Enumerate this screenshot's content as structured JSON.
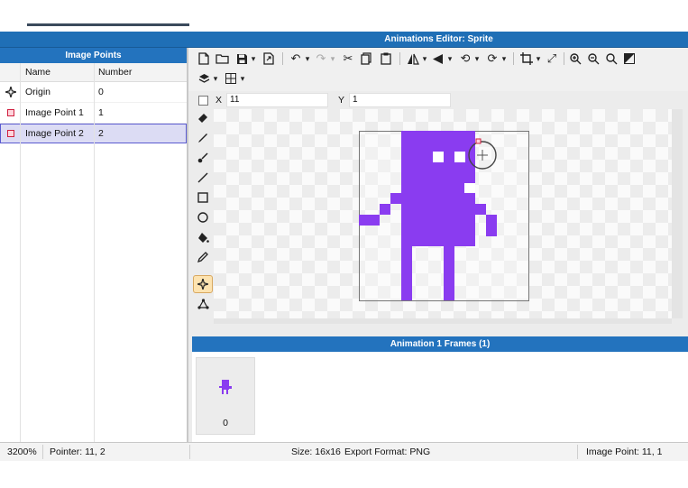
{
  "window": {
    "title": "Animations Editor: Sprite"
  },
  "image_points_panel": {
    "header": "Image Points",
    "columns": {
      "name": "Name",
      "number": "Number"
    },
    "rows": [
      {
        "name": "Origin",
        "number": "0",
        "icon": "origin-crosshair-icon"
      },
      {
        "name": "Image Point 1",
        "number": "1",
        "icon": "image-point-icon"
      },
      {
        "name": "Image Point 2",
        "number": "2",
        "icon": "image-point-icon",
        "selected": true
      }
    ]
  },
  "coords": {
    "x_label": "X",
    "x_value": "11",
    "y_label": "Y",
    "y_value": "1"
  },
  "frames": {
    "header": "Animation 1 Frames (1)",
    "items": [
      {
        "index": "0"
      }
    ]
  },
  "status": {
    "zoom": "3200%",
    "pointer": "Pointer: 11, 2",
    "size": "Size: 16x16",
    "export": "Export Format: PNG",
    "image_point": "Image Point: 11, 1"
  },
  "colors": {
    "sprite": "#8a3cf0",
    "accent_blue": "#2373be",
    "image_point_red": "#d02040"
  }
}
